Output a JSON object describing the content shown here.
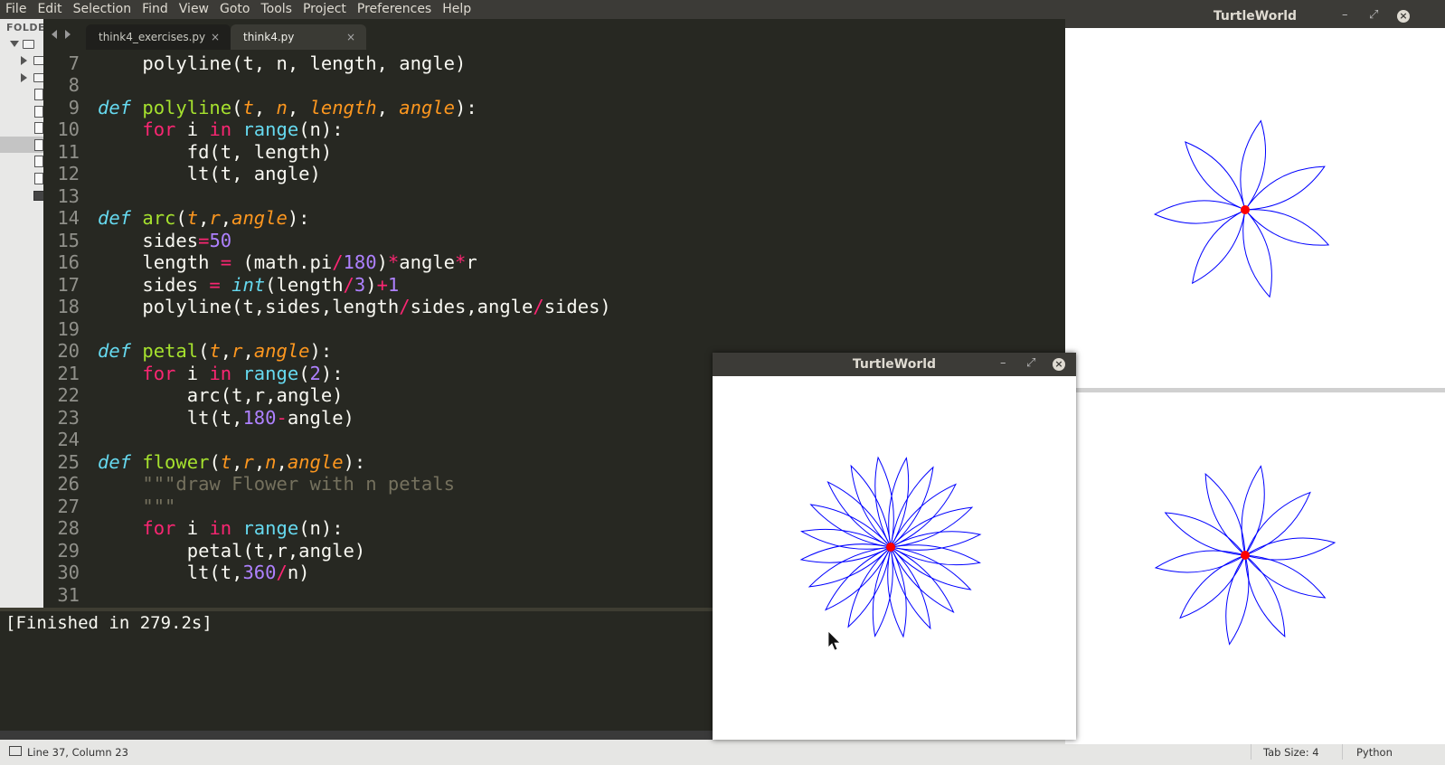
{
  "menu": [
    "File",
    "Edit",
    "Selection",
    "Find",
    "View",
    "Goto",
    "Tools",
    "Project",
    "Preferences",
    "Help"
  ],
  "sidebar": {
    "header": "FOLDE"
  },
  "tabs": [
    {
      "label": "think4_exercises.py",
      "close": "×"
    },
    {
      "label": "think4.py",
      "close": "×"
    }
  ],
  "editor": {
    "line_numbers": [
      "7",
      "8",
      "9",
      "10",
      "11",
      "12",
      "13",
      "14",
      "15",
      "16",
      "17",
      "18",
      "19",
      "20",
      "21",
      "22",
      "23",
      "24",
      "25",
      "26",
      "27",
      "28",
      "29",
      "30",
      "31"
    ],
    "lines": [
      "    polyline(t, n, length, angle)",
      "",
      "def polyline(t, n, length, angle):",
      "    for i in range(n):",
      "        fd(t, length)",
      "        lt(t, angle)",
      "",
      "def arc(t,r,angle):",
      "    sides=50",
      "    length = (math.pi/180)*angle*r",
      "    sides = int(length/3)+1",
      "    polyline(t,sides,length/sides,angle/sides)",
      "",
      "def petal(t,r,angle):",
      "    for i in range(2):",
      "        arc(t,r,angle)",
      "        lt(t,180-angle)",
      "",
      "def flower(t,r,n,angle):",
      "    \"\"\"draw Flower with n petals",
      "    \"\"\"",
      "    for i in range(n):",
      "        petal(t,r,angle)",
      "        lt(t,360/n)",
      ""
    ]
  },
  "output": {
    "text": "[Finished in 279.2s]"
  },
  "status": {
    "position": "Line 37, Column 23",
    "tab_size": "Tab Size: 4",
    "syntax": "Python"
  },
  "turtle_windows": [
    {
      "title": "TurtleWorld",
      "controls": [
        "–",
        "⤢",
        "×"
      ],
      "petals": 7
    },
    {
      "title": "TurtleWorld",
      "controls": [
        "–",
        "⤢",
        "×"
      ],
      "petals": 20
    },
    {
      "petals": 10
    }
  ],
  "colors": {
    "petal_stroke": "#0000ff",
    "turtle": "#ff0000",
    "editor_bg": "#272822",
    "title_bar": "#3c3b37"
  }
}
